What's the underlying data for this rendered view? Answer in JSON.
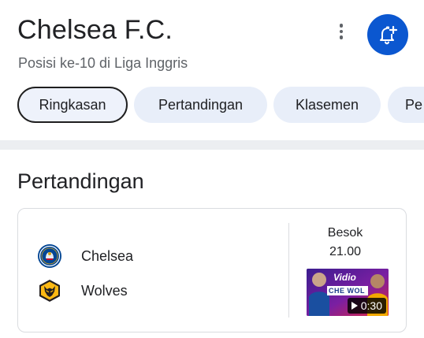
{
  "header": {
    "title": "Chelsea F.C.",
    "subtitle": "Posisi ke-10 di Liga Inggris",
    "more_icon": "more-vert-icon",
    "follow_icon": "bell-plus-icon",
    "accent_color": "#0b57d0"
  },
  "tabs": [
    {
      "label": "Ringkasan",
      "active": true
    },
    {
      "label": "Pertandingan",
      "active": false
    },
    {
      "label": "Klasemen",
      "active": false
    },
    {
      "label": "Pe",
      "active": false
    }
  ],
  "matches_section": {
    "title": "Pertandingan",
    "match": {
      "home_team": "Chelsea",
      "away_team": "Wolves",
      "day": "Besok",
      "time": "21.00",
      "video": {
        "brand": "Vidio",
        "caption": "CHE WOL",
        "duration": "0:30"
      }
    }
  }
}
